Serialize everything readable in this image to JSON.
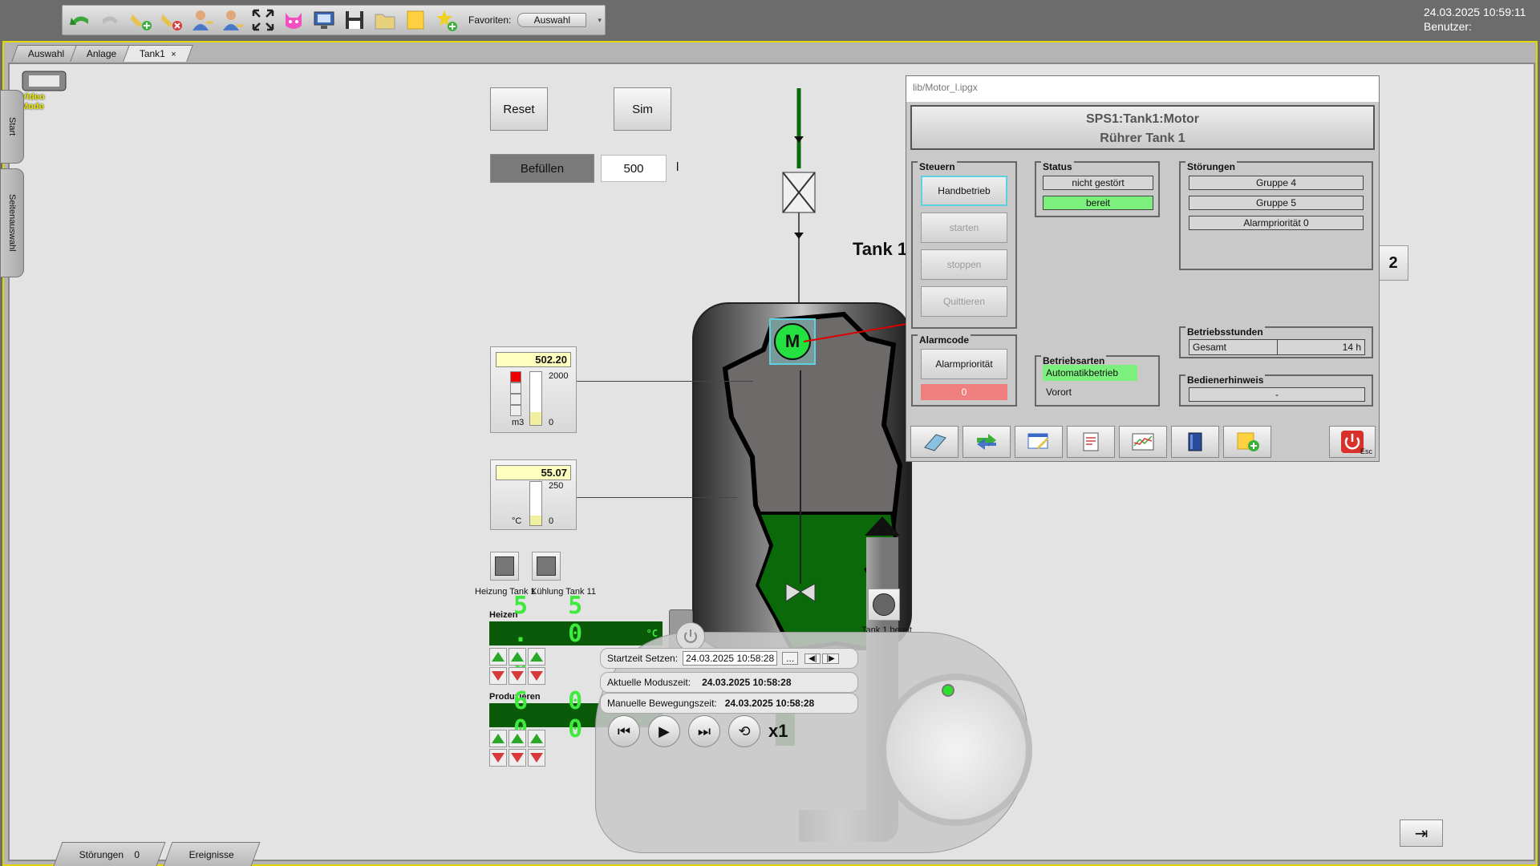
{
  "header": {
    "favorites_label": "Favoriten:",
    "favorites_select": "Auswahl",
    "date_time": "24.03.2025 10:59:11",
    "user_label": "Benutzer:"
  },
  "tabs": [
    {
      "label": "Auswahl"
    },
    {
      "label": "Anlage"
    },
    {
      "label": "Tank1",
      "close": "×"
    }
  ],
  "side_tabs": {
    "start": "Start",
    "page_select": "Seitenauswahl"
  },
  "video_mode": "Video Mode",
  "controls": {
    "reset": "Reset",
    "sim": "Sim",
    "fill": "Befüllen",
    "fill_value": "500",
    "fill_unit": "l"
  },
  "tank": {
    "label": "Tank 1",
    "motor_symbol": "M",
    "ready_label": "Tank 1 bereit",
    "page_number": "2"
  },
  "level_gauge": {
    "value": "502.20",
    "max": "2000",
    "min": "0",
    "unit": "m3",
    "fill_fraction": 0.25
  },
  "temp_gauge": {
    "value": "55.07",
    "max": "250",
    "min": "0",
    "unit": "°C",
    "fill_fraction": 0.22
  },
  "indicators": {
    "heating": "Heizung Tank 1",
    "cooling": "Kühlung Tank 11"
  },
  "heat_panel": {
    "title": "Heizen",
    "display": "5 5 . 0 0",
    "unit": "°C"
  },
  "produce_panel": {
    "title": "Produzieren",
    "display": "6 0 . 0 0"
  },
  "bottom_tabs": {
    "alarms_label": "Störungen",
    "alarms_count": "0",
    "events_label": "Ereignisse"
  },
  "faceplate": {
    "path": "lib/Motor_l.ipgx",
    "title_line1": "SPS1:Tank1:Motor",
    "title_line2": "Rührer Tank 1",
    "steuern": {
      "title": "Steuern",
      "buttons": [
        "Handbetrieb",
        "starten",
        "stoppen",
        "Quittieren"
      ]
    },
    "alarmcode": {
      "title": "Alarmcode",
      "button": "Alarmpriorität",
      "value": "0"
    },
    "status": {
      "title": "Status",
      "items": [
        "nicht gestört",
        "bereit"
      ]
    },
    "betriebsarten": {
      "title": "Betriebsarten",
      "items": [
        "Automatikbetrieb",
        "Vorort"
      ]
    },
    "stoerungen": {
      "title": "Störungen",
      "items": [
        "Gruppe 4",
        "Gruppe 5",
        "Alarmpriorität 0"
      ]
    },
    "betriebsstunden": {
      "title": "Betriebsstunden",
      "label": "Gesamt",
      "value": "14 h"
    },
    "bedienerhinweis": {
      "title": "Bedienerhinweis",
      "value": "-"
    },
    "esc_label": "Esc"
  },
  "playback": {
    "start_label": "Startzeit Setzen:",
    "start_value": "24.03.2025 10:58:28",
    "more": "...",
    "mode_label": "Aktuelle Moduszeit:",
    "mode_value": "24.03.2025 10:58:28",
    "manual_label": "Manuelle Bewegungszeit:",
    "manual_value": "24.03.2025 10:58:28",
    "speed": "x1"
  },
  "colors": {
    "accent_yellow": "#e2d600",
    "process_green": "#0a6a0a",
    "status_green": "#7cf07c",
    "alarm_red": "#f08080"
  }
}
